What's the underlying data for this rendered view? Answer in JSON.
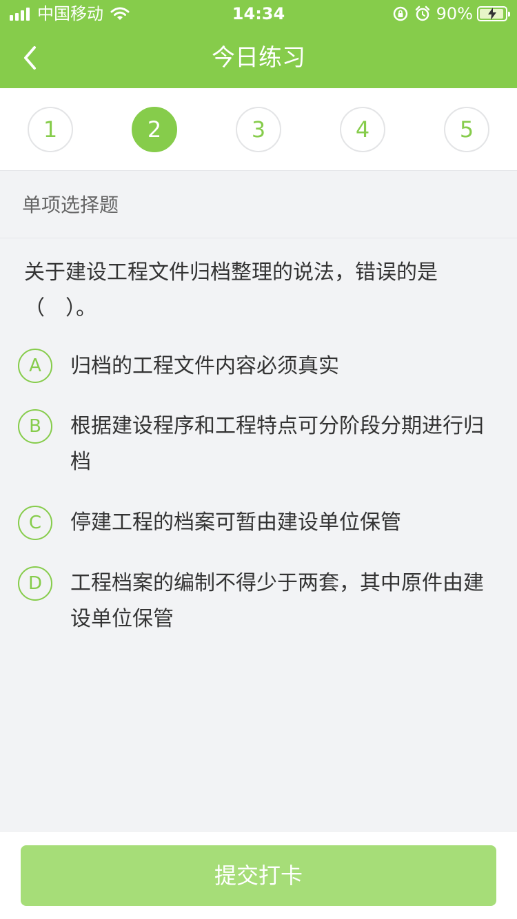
{
  "status_bar": {
    "carrier": "中国移动",
    "time": "14:34",
    "battery_percent": "90%",
    "icons": [
      "signal-icon",
      "wifi-icon",
      "rotation-lock-icon",
      "alarm-icon",
      "battery-charging-icon"
    ]
  },
  "nav": {
    "back_icon": "chevron-left-icon",
    "title": "今日练习"
  },
  "question_tabs": [
    "1",
    "2",
    "3",
    "4",
    "5"
  ],
  "active_tab": "2",
  "section": {
    "title": "单项选择题"
  },
  "question": {
    "stem": "关于建设工程文件归档整理的说法，错误的是（　）。",
    "options": [
      {
        "letter": "A",
        "text": "归档的工程文件内容必须真实"
      },
      {
        "letter": "B",
        "text": "根据建设程序和工程特点可分阶段分期进行归档"
      },
      {
        "letter": "C",
        "text": "停建工程的档案可暂由建设单位保管"
      },
      {
        "letter": "D",
        "text": "工程档案的编制不得少于两套，其中原件由建设单位保管"
      }
    ]
  },
  "footer": {
    "submit_label": "提交打卡"
  },
  "colors": {
    "brand_green": "#86cc4b",
    "submit_disabled": "#a6dd78",
    "background": "#f2f3f5",
    "text": "#333333",
    "muted_text": "#666666"
  }
}
